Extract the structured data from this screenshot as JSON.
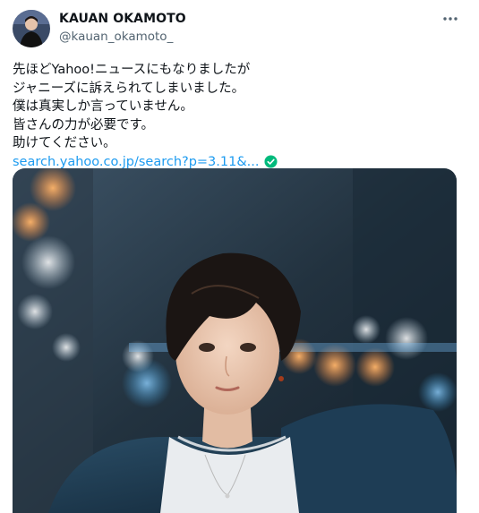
{
  "user": {
    "name": "KAUAN OKAMOTO",
    "handle": "@kauan_okamoto_"
  },
  "tweet": {
    "lines": [
      "先ほどYahoo!ニュースにもなりましたが",
      "ジャニーズに訴えられてしまいました。",
      "僕は真実しか言っていません。",
      "皆さんの力が必要です。",
      "助けてください。"
    ],
    "link_text": "search.yahoo.co.jp/search?p=3.11&..."
  },
  "icons": {
    "more": "more-horizontal-icon",
    "link_badge": "check-circle-icon"
  },
  "colors": {
    "link": "#1d9bf0",
    "badge": "#00ba7c",
    "secondary_text": "#536471"
  }
}
